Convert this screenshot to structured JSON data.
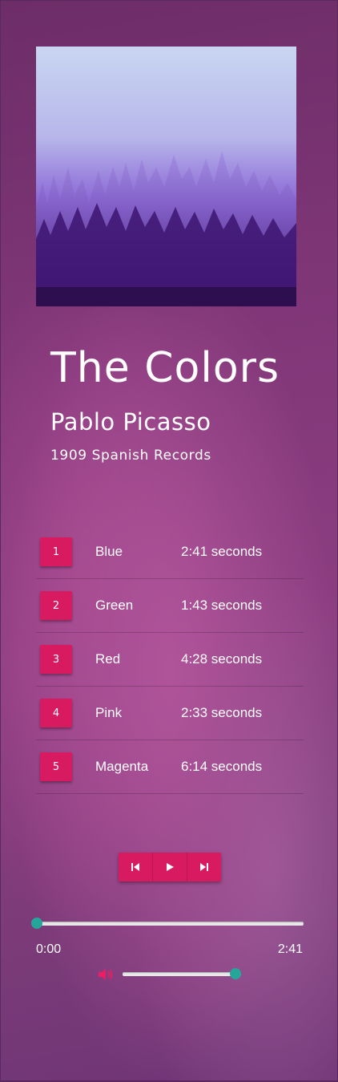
{
  "album": {
    "title": "The Colors",
    "artist": "Pablo Picasso",
    "label": "1909 Spanish Records"
  },
  "tracks": [
    {
      "number": "1",
      "name": "Blue",
      "duration": "2:41 seconds"
    },
    {
      "number": "2",
      "name": "Green",
      "duration": "1:43 seconds"
    },
    {
      "number": "3",
      "name": "Red",
      "duration": "4:28 seconds"
    },
    {
      "number": "4",
      "name": "Pink",
      "duration": "2:33 seconds"
    },
    {
      "number": "5",
      "name": "Magenta",
      "duration": "6:14 seconds"
    }
  ],
  "player": {
    "current_time": "0:00",
    "total_time": "2:41",
    "progress": 0.0,
    "volume": 0.95,
    "icons": [
      "skip-previous-icon",
      "play-icon",
      "skip-next-icon",
      "volume-icon"
    ]
  },
  "colors": {
    "accent": "#d81b60",
    "slider_thumb": "#26a69a",
    "volume_icon": "#e91e63"
  }
}
